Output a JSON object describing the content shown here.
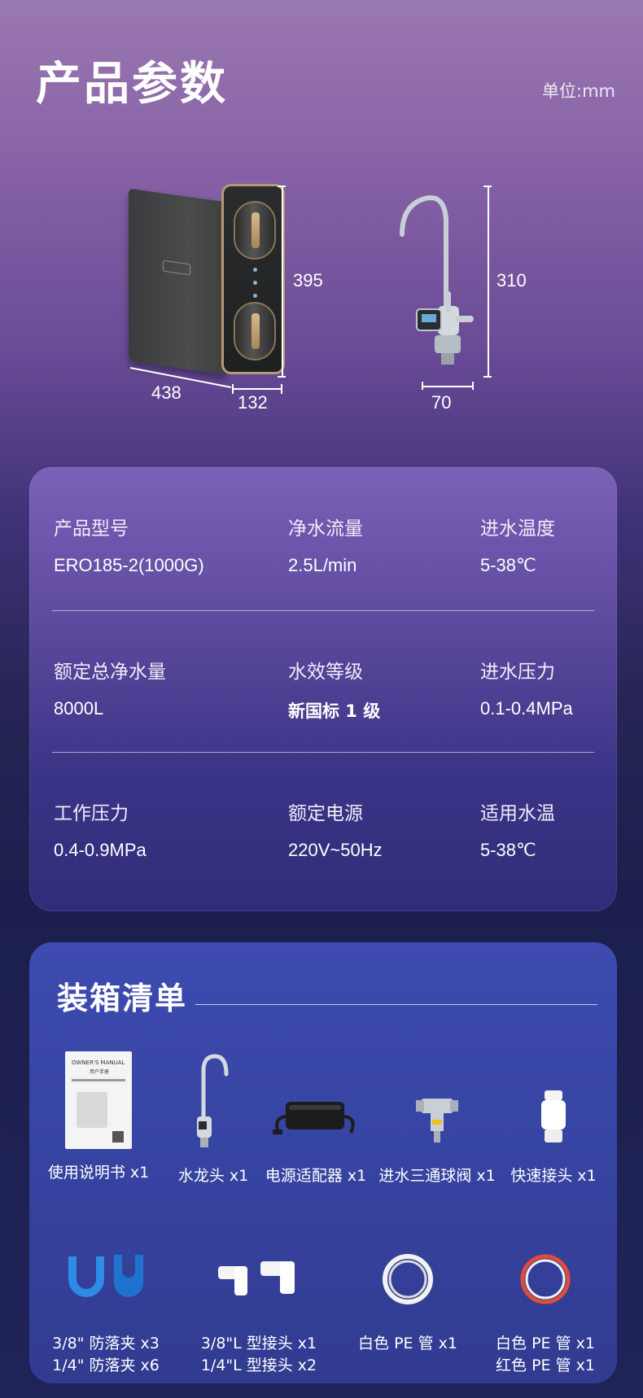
{
  "header": {
    "title": "产品参数",
    "unit": "单位:mm"
  },
  "dimensions": {
    "purifier_height": "395",
    "purifier_width": "438",
    "purifier_depth": "132",
    "faucet_height": "310",
    "faucet_base": "70"
  },
  "specs": {
    "rows": [
      [
        {
          "label": "产品型号",
          "value": "ERO185-2(1000G)"
        },
        {
          "label": "净水流量",
          "value": "2.5L/min"
        },
        {
          "label": "进水温度",
          "value": "5-38℃"
        }
      ],
      [
        {
          "label": "额定总净水量",
          "value": "8000L"
        },
        {
          "label": "水效等级",
          "value": "新国标 1 级"
        },
        {
          "label": "进水压力",
          "value": "0.1-0.4MPa"
        }
      ],
      [
        {
          "label": "工作压力",
          "value": "0.4-0.9MPa"
        },
        {
          "label": "额定电源",
          "value": "220V~50Hz"
        },
        {
          "label": "适用水温",
          "value": "5-38℃"
        }
      ]
    ]
  },
  "packing": {
    "title": "装箱清单",
    "manual_cover_title": "OWNER'S MANUAL",
    "manual_cover_subtitle": "用户手册",
    "items_row1": [
      {
        "label": "使用说明书 x1",
        "icon": "manual-icon"
      },
      {
        "label": "水龙头 x1",
        "icon": "faucet-icon"
      },
      {
        "label": "电源适配器 x1",
        "icon": "power-adapter-icon"
      },
      {
        "label": "进水三通球阀 x1",
        "icon": "ball-valve-icon"
      },
      {
        "label": "快速接头 x1",
        "icon": "quick-connector-icon"
      }
    ],
    "items_row2": [
      {
        "line1": "3/8\" 防落夹 x3",
        "line2": "1/4\" 防落夹 x6",
        "icon": "anti-drop-clip-icon"
      },
      {
        "line1": "3/8\"L 型接头 x1",
        "line2": "1/4\"L 型接头 x2",
        "icon": "l-connector-icon"
      },
      {
        "line1": "白色 PE 管 x1",
        "line2": "",
        "icon": "white-pe-tube-icon"
      },
      {
        "line1": "白色 PE 管 x1",
        "line2": "红色 PE 管 x1",
        "icon": "red-pe-tube-icon"
      }
    ]
  }
}
